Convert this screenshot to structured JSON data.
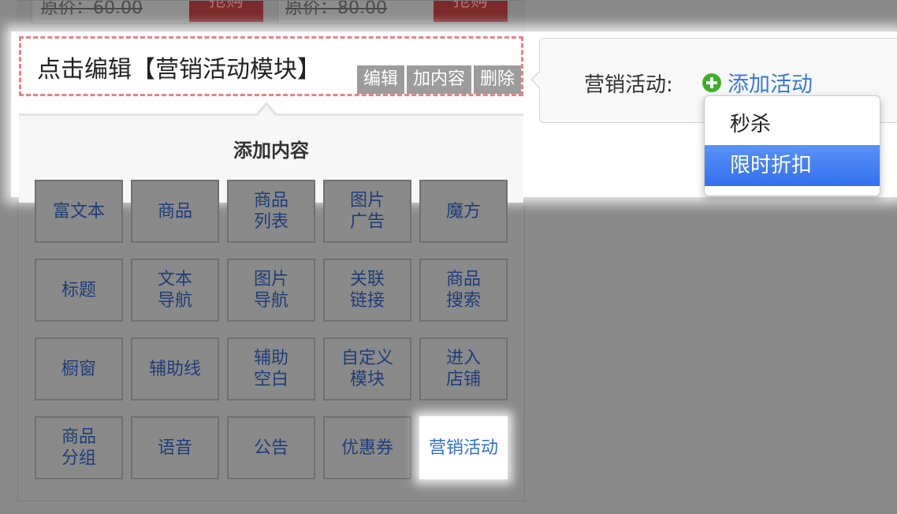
{
  "top_products": [
    {
      "original_price": "原价：60.00",
      "buy_label": "抢购"
    },
    {
      "original_price": "原价：80.00",
      "buy_label": "抢购"
    }
  ],
  "module": {
    "title": "点击编辑【营销活动模块】",
    "actions": [
      "编辑",
      "加内容",
      "删除"
    ]
  },
  "add_content": {
    "title": "添加内容",
    "items": [
      "富文本",
      "商品",
      "商品\n列表",
      "图片\n广告",
      "魔方",
      "标题",
      "文本\n导航",
      "图片\n导航",
      "关联\n链接",
      "商品\n搜索",
      "橱窗",
      "辅助线",
      "辅助\n空白",
      "自定义\n模块",
      "进入\n店铺",
      "商品\n分组",
      "语音",
      "公告",
      "优惠券",
      "营销活动"
    ],
    "active_index": 19
  },
  "activity_popup": {
    "label": "营销活动:",
    "add_label": "添加活动",
    "dropdown": {
      "options": [
        "秒杀",
        "限时折扣"
      ],
      "selected": "限时折扣"
    }
  },
  "colors": {
    "accent_blue": "#3a78d8",
    "plus_green": "#3fae2a",
    "dashed_border": "#e98282",
    "selected_option": "#3170ef"
  }
}
